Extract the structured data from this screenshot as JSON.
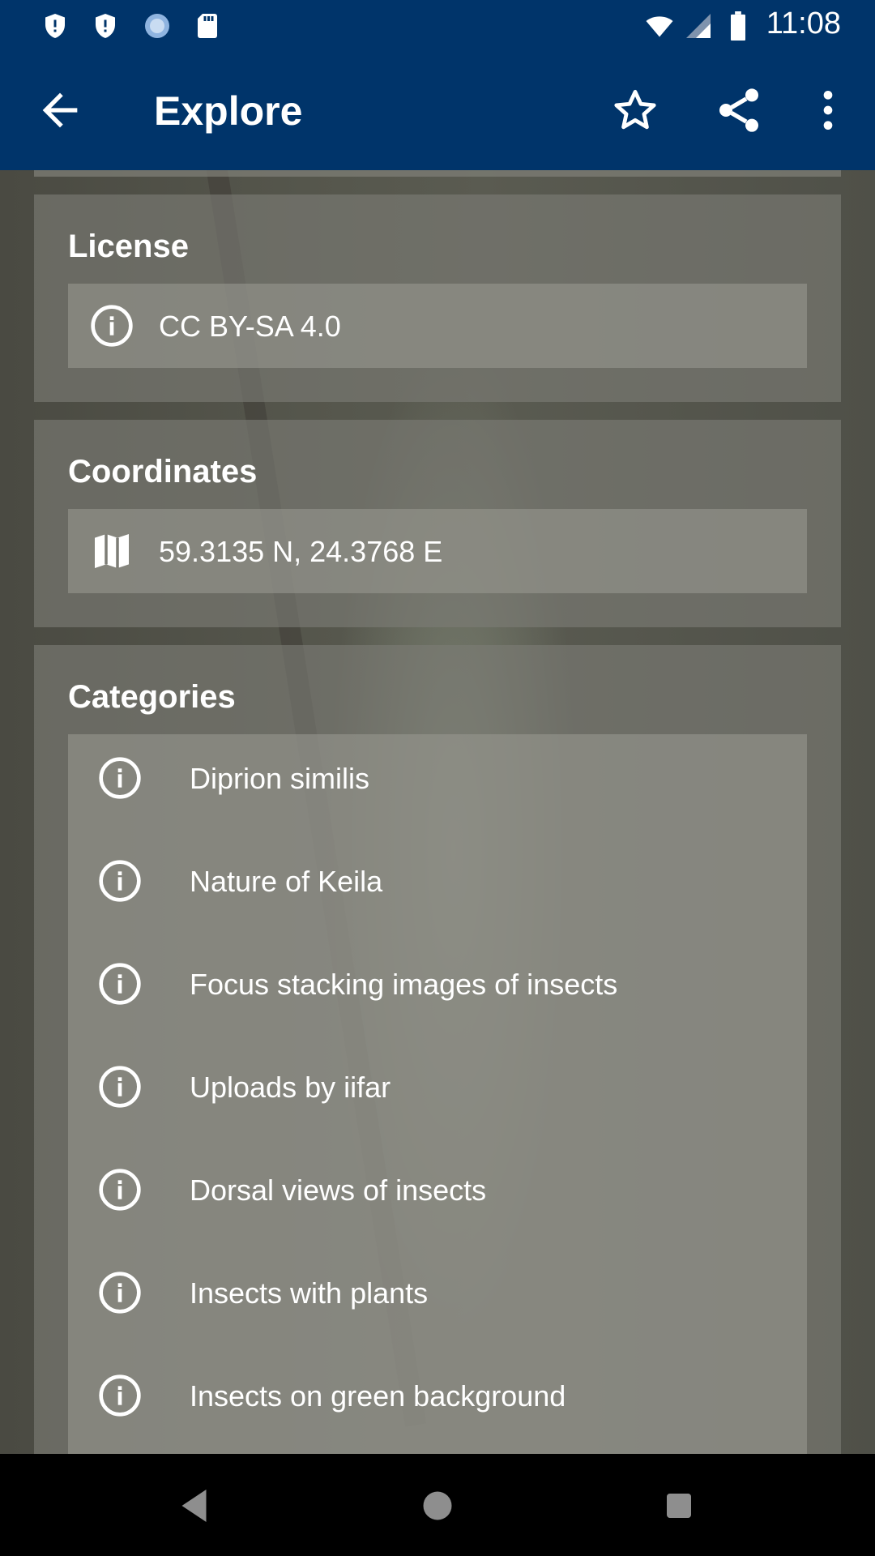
{
  "status_bar": {
    "time": "11:08",
    "icons": [
      "shield-icon",
      "shield-icon",
      "circle-icon",
      "sd-card-icon",
      "wifi-icon",
      "signal-icon",
      "battery-icon"
    ]
  },
  "app_bar": {
    "title": "Explore",
    "back_icon": "arrow-back-icon",
    "actions": [
      "star-icon",
      "share-icon",
      "more-vert-icon"
    ]
  },
  "license": {
    "heading": "License",
    "value": "CC BY-SA 4.0",
    "icon": "info-icon"
  },
  "coordinates": {
    "heading": "Coordinates",
    "value": "59.3135 N, 24.3768 E",
    "icon": "map-icon"
  },
  "categories": {
    "heading": "Categories",
    "items": [
      "Diprion similis",
      "Nature of Keila",
      "Focus stacking images of insects",
      "Uploads by iifar",
      "Dorsal views of insects",
      "Insects with plants",
      "Insects on green background"
    ]
  },
  "colors": {
    "app_bar": "#00346a",
    "nav_bar": "#000000"
  }
}
